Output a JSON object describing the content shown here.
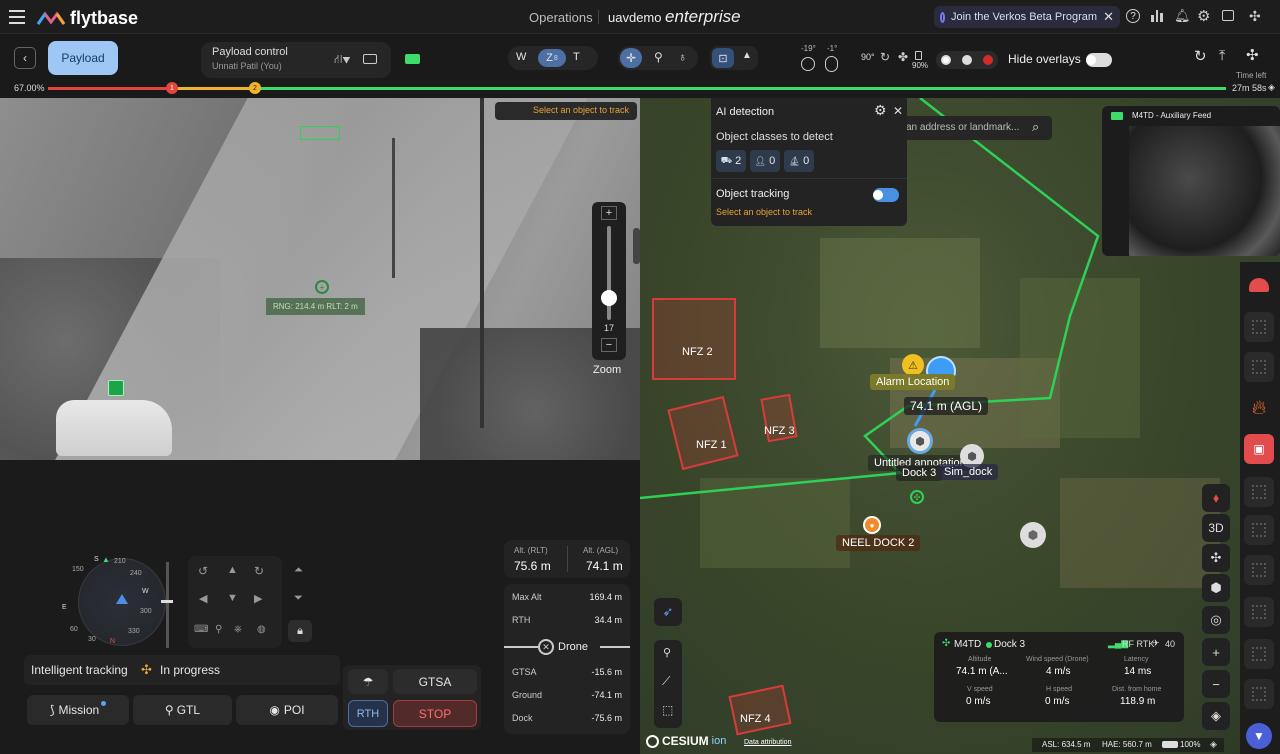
{
  "topbar": {
    "brand": "flytbase",
    "operations": "Operations",
    "org": "uavdemo",
    "edition": "enterprise",
    "beta_text": "Join the Verkos Beta Program"
  },
  "controls": {
    "payload_btn": "Payload",
    "payload_control_title": "Payload control",
    "payload_control_user": "Unnati Patil (You)",
    "lens_w": "W",
    "lens_z": "Z",
    "lens_z_sub": "8",
    "lens_t": "T",
    "gimbal_yaw": "-19°",
    "gimbal_pitch": "-1°",
    "angle_90": "90°",
    "battery": "90%",
    "hide_overlays": "Hide overlays",
    "time_left_label": "Time left",
    "time_left_value": "27m 58s",
    "progress_label": "67.00%",
    "marker_1": "1",
    "marker_2": "2"
  },
  "camera": {
    "select_object": "Select an object to track",
    "zoom_value": "17",
    "zoom_label": "Zoom",
    "target_label": "RNG: 214.4 m  RLT: 2 m"
  },
  "ai_panel": {
    "title": "AI detection",
    "classes_label": "Object classes to detect",
    "class_vehicle": "2",
    "class_person": "0",
    "class_boat": "0",
    "tracking_label": "Object tracking",
    "tracking_hint": "Select an object to track",
    "tracking_on": true
  },
  "search": {
    "placeholder": "an address or landmark..."
  },
  "aux_feed": {
    "title": "M4TD - Auxiliary Feed"
  },
  "map_labels": {
    "nfz_1": "NFZ 1",
    "nfz_2": "NFZ 2",
    "nfz_3": "NFZ 3",
    "nfz_4": "NFZ 4",
    "alarm_location": "Alarm Location",
    "agl": "74.1 m (AGL)",
    "untitled_annotation": "Untitled annotation",
    "dock_3": "Dock 3",
    "sim_dock": "Sim_dock",
    "neel_dock": "NEEL DOCK 2",
    "btn_3d": "3D",
    "cesium": "CESIUM",
    "cesium_ion": "ion",
    "data_attribution": "Data attribution",
    "asl": "ASL: 634.5 m",
    "hae": "HAE: 560.7 m",
    "battery_pct": "100%"
  },
  "telemetry_card": {
    "drone": "M4TD",
    "dock": "Dock 3",
    "link": "RF RTK",
    "sats": "40",
    "altitude_label": "Altitude",
    "altitude_value": "74.1 m (A...",
    "wind_label": "Wind speed (Drone)",
    "wind_value": "4 m/s",
    "latency_label": "Latency",
    "latency_value": "14 ms",
    "vspeed_label": "V speed",
    "vspeed_value": "0 m/s",
    "hspeed_label": "H speed",
    "hspeed_value": "0 m/s",
    "dist_label": "Dist. from home",
    "dist_value": "118.9 m"
  },
  "lower_panel": {
    "alt_rlt_label": "Alt. (RLT)",
    "alt_rlt_value": "75.6 m",
    "alt_agl_label": "Alt. (AGL)",
    "alt_agl_value": "74.1 m",
    "max_alt_label": "Max Alt",
    "max_alt_value": "169.4 m",
    "rth_label": "RTH",
    "rth_value": "34.4 m",
    "drone_label": "Drone",
    "gtsa_label": "GTSA",
    "gtsa_value": "-15.6 m",
    "ground_label": "Ground",
    "ground_value": "-74.1 m",
    "dock_label": "Dock",
    "dock_value": "-75.6 m",
    "intelligent_tracking": "Intelligent tracking",
    "in_progress": "In progress",
    "mission_btn": "Mission",
    "gtl_btn": "GTL",
    "poi_btn": "POI",
    "gtsa_btn": "GTSA",
    "rth_btn": "RTH",
    "stop_btn": "STOP"
  },
  "compass": {
    "n": "N",
    "s": "S",
    "e": "E",
    "w": "W",
    "t30": "30",
    "t60": "60",
    "t150": "150",
    "t210": "210",
    "t240": "240",
    "t300": "300",
    "t330": "330"
  },
  "colors": {
    "accent_blue": "#5ba4f5",
    "stop_red": "#e24c4c",
    "progress_green": "#3ddc6b",
    "nfz_red": "#d83b3b"
  }
}
